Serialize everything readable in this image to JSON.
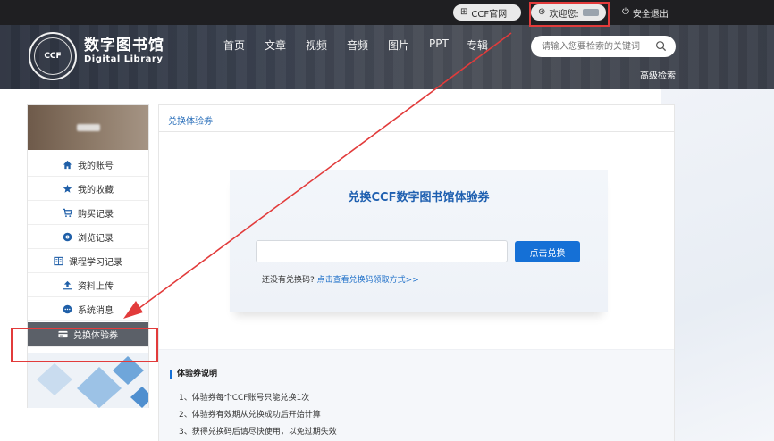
{
  "topbar": {
    "ccf_label": "CCF官网",
    "welcome_label": "欢迎您:",
    "logout_label": "安全退出"
  },
  "header": {
    "logo_cn": "数字图书馆",
    "logo_en": "Digital Library",
    "logo_badge": "CCF",
    "nav": [
      "首页",
      "文章",
      "视频",
      "音频",
      "图片",
      "PPT",
      "专辑"
    ],
    "search_placeholder": "请输入您要检索的关键词",
    "advanced_search": "高级检索"
  },
  "sidebar": {
    "items": [
      {
        "label": "我的账号",
        "icon": "home-icon"
      },
      {
        "label": "我的收藏",
        "icon": "star-icon"
      },
      {
        "label": "购买记录",
        "icon": "cart-icon"
      },
      {
        "label": "浏览记录",
        "icon": "eye-icon"
      },
      {
        "label": "课程学习记录",
        "icon": "book-icon"
      },
      {
        "label": "资料上传",
        "icon": "upload-icon"
      },
      {
        "label": "系统消息",
        "icon": "message-icon"
      },
      {
        "label": "兑换体验券",
        "icon": "card-icon",
        "active": true
      }
    ]
  },
  "main": {
    "tab_label": "兑换体验券",
    "card_title": "兑换CCF数字图书馆体验券",
    "code_input_value": "",
    "redeem_button": "点击兑换",
    "hint_prefix": "还没有兑换码?",
    "hint_link": "点击查看兑换码领取方式>>"
  },
  "notes": {
    "title": "体验券说明",
    "items": [
      "1、体验券每个CCF账号只能兑换1次",
      "2、体验券有效期从兑换成功后开始计算",
      "3、获得兑换码后请尽快使用，以免过期失效"
    ]
  },
  "colors": {
    "accent": "#1570d6",
    "annotation": "#e23b3b",
    "active_menu": "#5b6068"
  }
}
